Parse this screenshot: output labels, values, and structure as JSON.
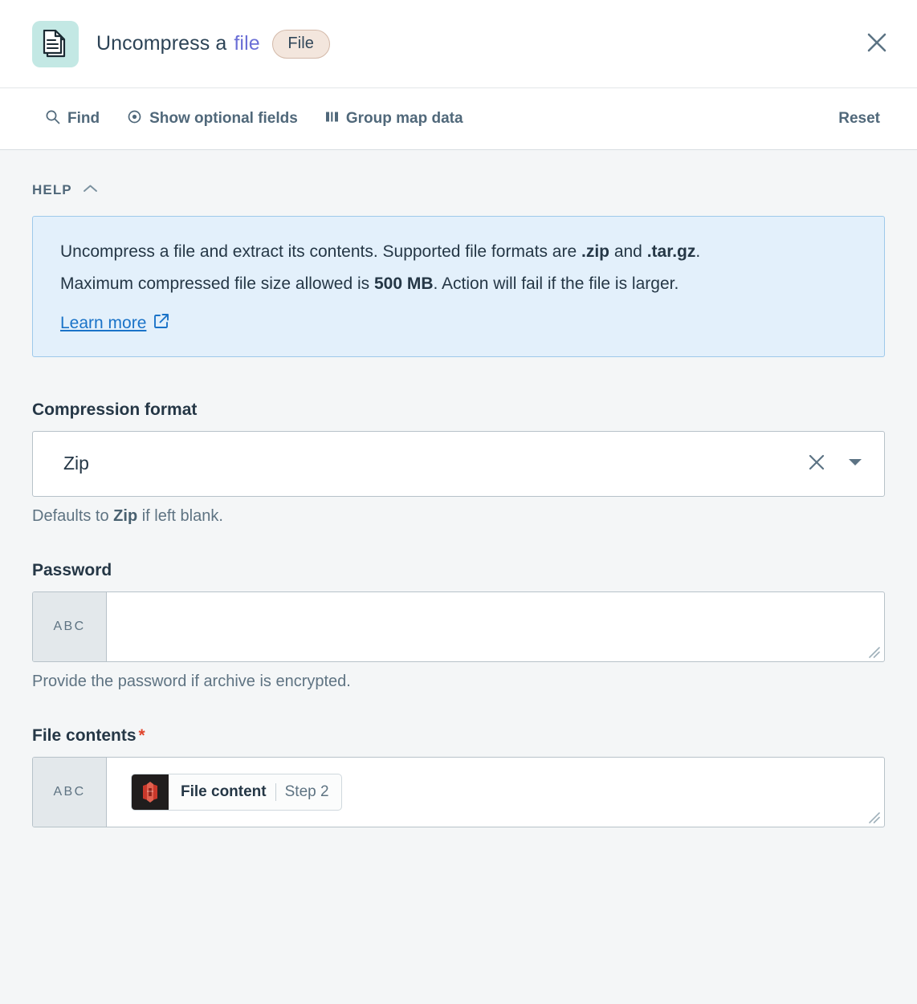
{
  "header": {
    "icon": "document-pages-icon",
    "title_main": "Uncompress a",
    "title_accent": "file",
    "badge": "File",
    "close_icon": "close-icon"
  },
  "toolbar": {
    "find_label": "Find",
    "find_icon": "search-icon",
    "optional_label": "Show optional fields",
    "optional_icon": "eye-icon",
    "group_label": "Group map data",
    "group_icon": "bar-chart-icon",
    "reset_label": "Reset"
  },
  "help": {
    "section_label": "HELP",
    "collapse_icon": "chevron-up-icon",
    "line1_a": "Uncompress a file and extract its contents. Supported file formats are ",
    "line1_b": ".zip",
    "line1_c": " and ",
    "line1_d": ".tar.gz",
    "line1_e": ".",
    "line2_a": "Maximum compressed file size allowed is ",
    "line2_b": "500 MB",
    "line2_c": ". Action will fail if the file is larger.",
    "learn_more": "Learn more",
    "learn_more_icon": "external-link-icon"
  },
  "fields": {
    "compression": {
      "label": "Compression format",
      "value": "Zip",
      "clear_icon": "close-icon",
      "dropdown_icon": "chevron-down-icon",
      "hint_a": "Defaults to ",
      "hint_b": "Zip",
      "hint_c": " if left blank."
    },
    "password": {
      "label": "Password",
      "prefix": "ABC",
      "value": "",
      "hint": "Provide the password if archive is encrypted."
    },
    "file_contents": {
      "label": "File contents",
      "required_marker": "*",
      "prefix": "ABC",
      "token_name": "File content",
      "token_step": "Step 2",
      "token_icon": "s3-bucket-icon"
    }
  },
  "colors": {
    "page_bg": "#f4f6f7",
    "accent_link": "#1a73c8",
    "help_bg": "#e3f0fb",
    "help_border": "#9ec9ea",
    "badge_bg": "#f3e6dd",
    "app_icon_bg": "#c3e8e4",
    "required": "#e0452c",
    "title_accent": "#6b6fd6"
  }
}
